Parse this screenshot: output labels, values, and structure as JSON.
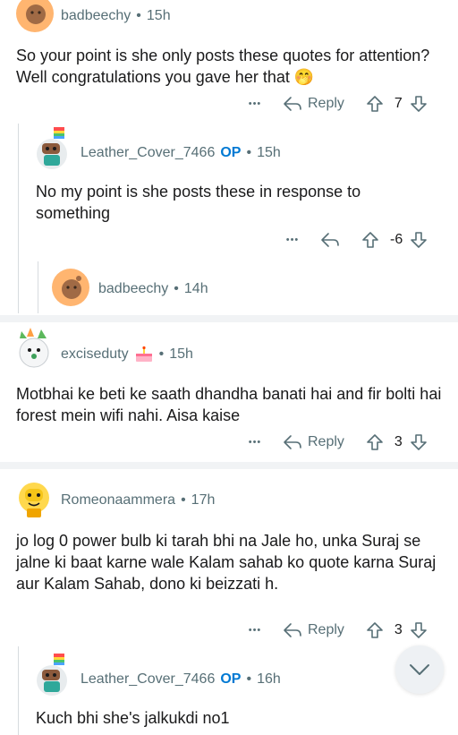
{
  "comments": [
    {
      "username": "badbeechy",
      "time": "15h",
      "body": "So your point is she only posts these quotes for attention? Well congratulations you gave her that 🤭",
      "reply_label": "Reply",
      "score": "7"
    },
    {
      "username": "Leather_Cover_7466",
      "op": "OP",
      "time": "15h",
      "body": "No my point is she posts these in response to something",
      "score": "-6"
    },
    {
      "username": "badbeechy",
      "time": "14h"
    },
    {
      "username": "exciseduty",
      "time": "15h",
      "body": "Motbhai ke beti ke saath dhandha banati hai and fir bolti hai forest mein wifi nahi. Aisa kaise",
      "reply_label": "Reply",
      "score": "3"
    },
    {
      "username": "Romeonaammera",
      "time": "17h",
      "body": "jo log 0 power bulb ki tarah bhi na Jale ho, unka Suraj se jalne ki baat karne wale Kalam sahab ko quote karna Suraj aur Kalam Sahab, dono ki beizzati h.",
      "reply_label": "Reply",
      "score": "3"
    },
    {
      "username": "Leather_Cover_7466",
      "op": "OP",
      "time": "16h",
      "body": "Kuch bhi she's jalkukdi no1"
    }
  ],
  "separator": "•",
  "more_glyph": "•••",
  "colors": {
    "accent_op": "#0079d3",
    "meta_gray": "#576f76",
    "avatar_orange": "#ffb570",
    "divider": "#f1f3f5"
  }
}
